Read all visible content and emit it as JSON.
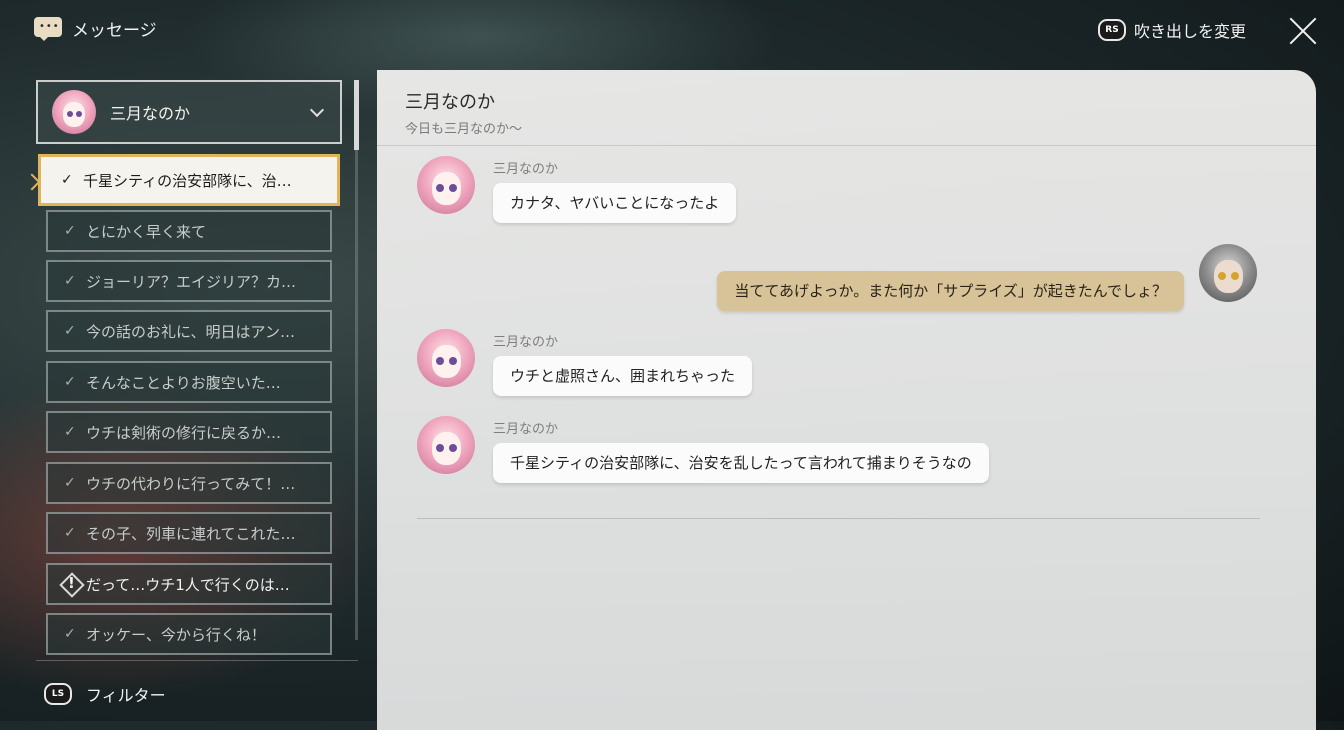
{
  "header": {
    "title": "メッセージ",
    "change_bubble_badge": "RS",
    "change_bubble_label": "吹き出しを変更"
  },
  "contact_select": {
    "name": "三月なのか"
  },
  "conversations": [
    {
      "text": "千星シティの治安部隊に、治…",
      "state": "done",
      "active": true
    },
    {
      "text": "とにかく早く来て",
      "state": "done"
    },
    {
      "text": "ジョーリア？エイジリア？カ…",
      "state": "done"
    },
    {
      "text": "今の話のお礼に、明日はアン…",
      "state": "done"
    },
    {
      "text": "そんなことよりお腹空いた…",
      "state": "done"
    },
    {
      "text": "ウチは剣術の修行に戻るか…",
      "state": "done"
    },
    {
      "text": "ウチの代わりに行ってみて！…",
      "state": "done"
    },
    {
      "text": "その子、列車に連れてこれた…",
      "state": "done"
    },
    {
      "text": "だって…ウチ1人で行くのは…",
      "state": "alert"
    },
    {
      "text": "オッケー、今から行くね！",
      "state": "done"
    }
  ],
  "filter": {
    "badge": "LS",
    "label": "フィルター"
  },
  "chat": {
    "title": "三月なのか",
    "subtitle": "今日も三月なのか〜",
    "messages": [
      {
        "sender": "三月なのか",
        "text": "カナタ、ヤバいことになったよ",
        "direction": "incoming"
      },
      {
        "sender": "",
        "text": "当ててあげよっか。また何か「サプライズ」が起きたんでしょ？",
        "direction": "outgoing"
      },
      {
        "sender": "三月なのか",
        "text": "ウチと虚照さん、囲まれちゃった",
        "direction": "incoming"
      },
      {
        "sender": "三月なのか",
        "text": "千星シティの治安部隊に、治安を乱したって言われて捕まりそうなの",
        "direction": "incoming"
      }
    ]
  },
  "colors": {
    "accent_gold": "#e2b45a",
    "outgoing_bubble": "#d7c397",
    "incoming_bubble": "#fbfbfb"
  }
}
